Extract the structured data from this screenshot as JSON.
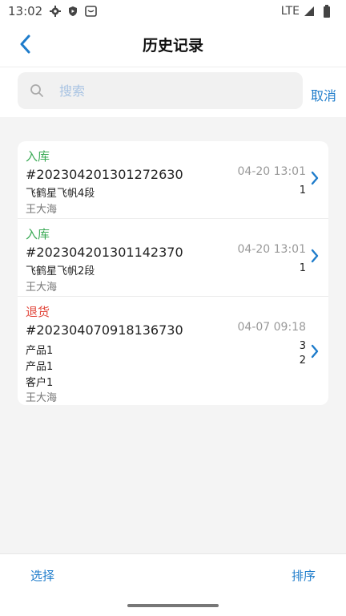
{
  "status_bar": {
    "time": "13:02",
    "network": "LTE",
    "icons": [
      "settings-gear-icon",
      "shield-icon",
      "inbox-icon",
      "signal-icon",
      "battery-icon"
    ]
  },
  "header": {
    "title": "历史记录",
    "back_icon": "chevron-left-icon"
  },
  "search": {
    "placeholder": "搜索",
    "value": "",
    "cancel_label": "取消",
    "icon": "search-icon"
  },
  "records": [
    {
      "type": "入库",
      "type_color": "#3aaa55",
      "order_no": "#202304201301272630",
      "time": "04-20 13:01",
      "items": [
        {
          "name": "飞鹤星飞帆4段",
          "qty": "1"
        }
      ],
      "customer": "",
      "operator": "王大海"
    },
    {
      "type": "入库",
      "type_color": "#3aaa55",
      "order_no": "#202304201301142370",
      "time": "04-20 13:01",
      "items": [
        {
          "name": "飞鹤星飞帆2段",
          "qty": "1"
        }
      ],
      "customer": "",
      "operator": "王大海"
    },
    {
      "type": "退货",
      "type_color": "#e2473c",
      "order_no": "#202304070918136730",
      "time": "04-07 09:18",
      "items": [
        {
          "name": "产品1",
          "qty": "3"
        },
        {
          "name": "产品1",
          "qty": "2"
        }
      ],
      "customer": "客户1",
      "operator": "王大海"
    }
  ],
  "bottom": {
    "select_label": "选择",
    "sort_label": "排序"
  },
  "colors": {
    "accent": "#1e7ccb",
    "in_stock": "#3aaa55",
    "return": "#e2473c"
  }
}
